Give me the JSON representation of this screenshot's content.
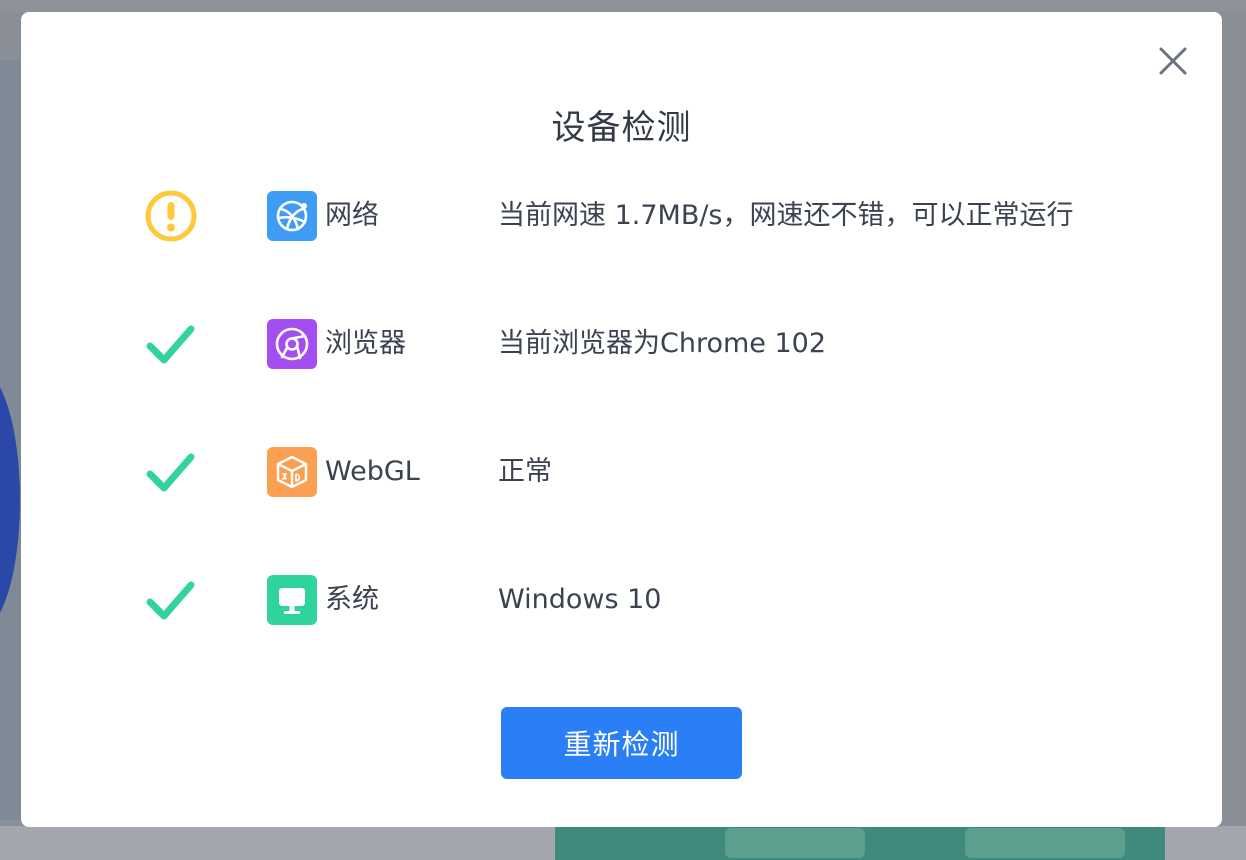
{
  "dialog": {
    "title": "设备检测",
    "retry_label": "重新检测",
    "close_icon": "close-icon"
  },
  "checks": [
    {
      "status": "warning",
      "status_icon": "warning-circle-icon",
      "icon": "network-globe-icon",
      "icon_color": "#3f9cf5",
      "label": "网络",
      "result": "当前网速 1.7MB/s，网速还不错，可以正常运行"
    },
    {
      "status": "ok",
      "status_icon": "checkmark-icon",
      "icon": "browser-chrome-icon",
      "icon_color": "#a34ef0",
      "label": "浏览器",
      "result": "当前浏览器为Chrome 102"
    },
    {
      "status": "ok",
      "status_icon": "checkmark-icon",
      "icon": "webgl-cube-icon",
      "icon_color": "#fba052",
      "label": "WebGL",
      "result": "正常"
    },
    {
      "status": "ok",
      "status_icon": "checkmark-icon",
      "icon": "system-monitor-icon",
      "icon_color": "#2fd49a",
      "label": "系统",
      "result": "Windows 10"
    }
  ],
  "colors": {
    "warning": "#ffc93c",
    "ok": "#34d399",
    "primary_button": "#2b7ff6",
    "text": "#3b4350"
  }
}
